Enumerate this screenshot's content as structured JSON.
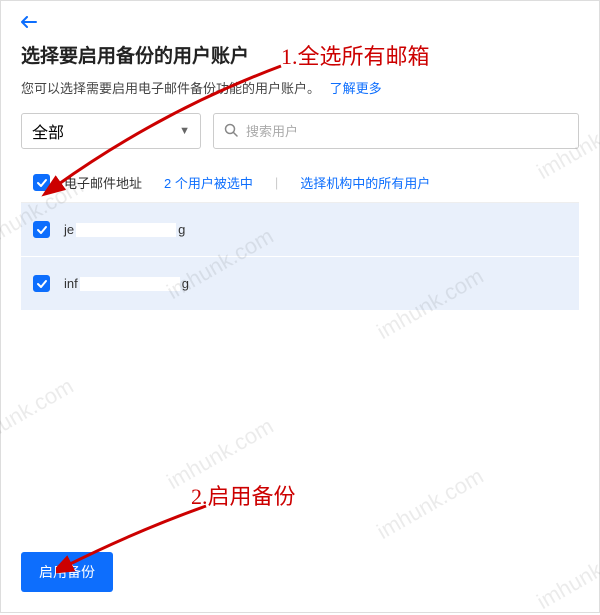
{
  "back_icon": "arrow-left",
  "title": "选择要启用备份的用户账户",
  "subtitle": "您可以选择需要启用电子邮件备份功能的用户账户。",
  "learn_more": "了解更多",
  "filter": {
    "selected": "全部",
    "search_placeholder": "搜索用户"
  },
  "table_header": {
    "email_label": "电子邮件地址",
    "selected_count": "2 个用户被选中",
    "select_org": "选择机构中的所有用户"
  },
  "users": [
    {
      "email_prefix": "je",
      "email_suffix": "g",
      "checked": true
    },
    {
      "email_prefix": "inf",
      "email_suffix": "g",
      "checked": true
    }
  ],
  "enable_button": "启用备份",
  "annotations": {
    "a1": "1.全选所有邮箱",
    "a2": "2.启用备份"
  },
  "watermark": "imhunk.com"
}
